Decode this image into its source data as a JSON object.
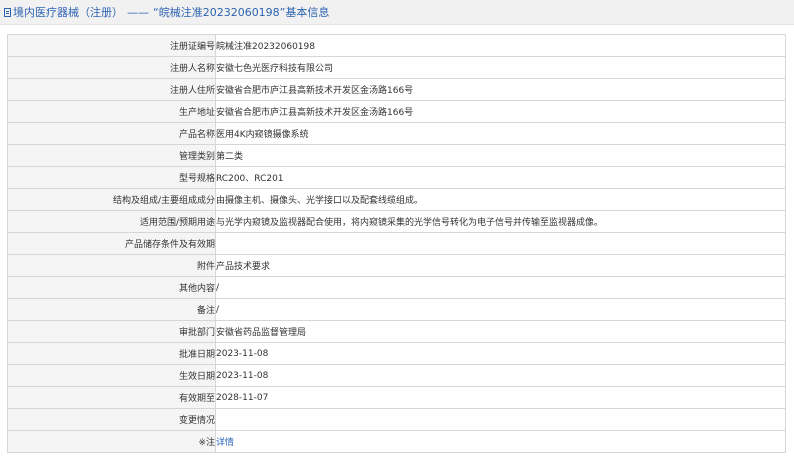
{
  "breadcrumb": {
    "section": "境内医疗器械（注册）",
    "separator": "——",
    "title": "“皖械注准20232060198”基本信息"
  },
  "rows": [
    {
      "label": "注册证编号",
      "value": "皖械注准20232060198"
    },
    {
      "label": "注册人名称",
      "value": "安徽七色光医疗科技有限公司"
    },
    {
      "label": "注册人住所",
      "value": "安徽省合肥市庐江县高新技术开发区金汤路166号"
    },
    {
      "label": "生产地址",
      "value": "安徽省合肥市庐江县高新技术开发区金汤路166号"
    },
    {
      "label": "产品名称",
      "value": "医用4K内窥镜摄像系统"
    },
    {
      "label": "管理类别",
      "value": "第二类"
    },
    {
      "label": "型号规格",
      "value": "RC200、RC201"
    },
    {
      "label": "结构及组成/主要组成成分",
      "value": "由摄像主机、摄像头、光学接口以及配套线缆组成。"
    },
    {
      "label": "适用范围/预期用途",
      "value": "与光学内窥镜及监视器配合使用，将内窥镜采集的光学信号转化为电子信号并传输至监视器成像。"
    },
    {
      "label": "产品储存条件及有效期",
      "value": ""
    },
    {
      "label": "附件",
      "value": "产品技术要求"
    },
    {
      "label": "其他内容",
      "value": "/"
    },
    {
      "label": "备注",
      "value": "/"
    },
    {
      "label": "审批部门",
      "value": "安徽省药品监督管理局"
    },
    {
      "label": "批准日期",
      "value": "2023-11-08"
    },
    {
      "label": "生效日期",
      "value": "2023-11-08"
    },
    {
      "label": "有效期至",
      "value": "2028-11-07"
    },
    {
      "label": "变更情况",
      "value": ""
    },
    {
      "label": "※注",
      "value": "详情",
      "is_link": true
    }
  ],
  "colors": {
    "accent": "#2d64b3",
    "label_bg": "#f5f5f5",
    "border": "#d6d6d6",
    "header_bg": "#f1f1f1"
  }
}
